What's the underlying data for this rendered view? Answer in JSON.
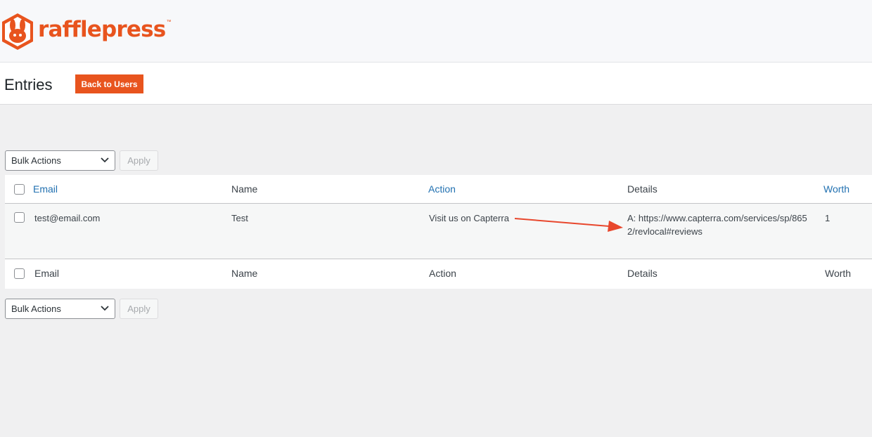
{
  "brand": {
    "name": "rafflepress",
    "tm": "™",
    "color": "#e8541e"
  },
  "header": {
    "title": "Entries",
    "back_button": "Back to Users"
  },
  "bulk_top": {
    "selected": "Bulk Actions",
    "apply": "Apply"
  },
  "bulk_bottom": {
    "selected": "Bulk Actions",
    "apply": "Apply"
  },
  "table": {
    "columns": {
      "email": "Email",
      "name": "Name",
      "action": "Action",
      "details": "Details",
      "worth": "Worth"
    },
    "rows": [
      {
        "email": "test@email.com",
        "name": "Test",
        "action": "Visit us on Capterra",
        "details": "A: https://www.capterra.com/services/sp/8652/revlocal#reviews",
        "worth": "1"
      }
    ],
    "footer": {
      "email": "Email",
      "name": "Name",
      "action": "Action",
      "details": "Details",
      "worth": "Worth"
    }
  },
  "annotation_color": "#e8472d"
}
